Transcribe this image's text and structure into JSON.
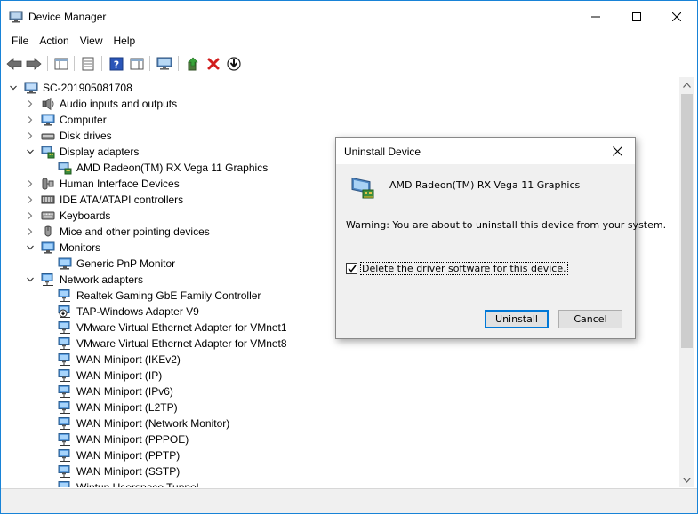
{
  "window": {
    "title": "Device Manager",
    "accent": "#1883d7"
  },
  "menu": [
    "File",
    "Action",
    "View",
    "Help"
  ],
  "tree": {
    "root": "SC-201905081708",
    "items": [
      {
        "label": "Audio inputs and outputs",
        "level": 1,
        "expanded": false,
        "icon": "speaker-icon"
      },
      {
        "label": "Computer",
        "level": 1,
        "expanded": false,
        "icon": "computer-icon"
      },
      {
        "label": "Disk drives",
        "level": 1,
        "expanded": false,
        "icon": "disk-drive-icon"
      },
      {
        "label": "Display adapters",
        "level": 1,
        "expanded": true,
        "icon": "display-adapter-icon"
      },
      {
        "label": "AMD Radeon(TM) RX Vega 11 Graphics",
        "level": 2,
        "icon": "display-adapter-icon"
      },
      {
        "label": "Human Interface Devices",
        "level": 1,
        "expanded": false,
        "icon": "hid-icon"
      },
      {
        "label": "IDE ATA/ATAPI controllers",
        "level": 1,
        "expanded": false,
        "icon": "ide-controller-icon"
      },
      {
        "label": "Keyboards",
        "level": 1,
        "expanded": false,
        "icon": "keyboard-icon"
      },
      {
        "label": "Mice and other pointing devices",
        "level": 1,
        "expanded": false,
        "icon": "mouse-icon"
      },
      {
        "label": "Monitors",
        "level": 1,
        "expanded": true,
        "icon": "monitor-icon"
      },
      {
        "label": "Generic PnP Monitor",
        "level": 2,
        "icon": "monitor-icon"
      },
      {
        "label": "Network adapters",
        "level": 1,
        "expanded": true,
        "icon": "network-icon"
      },
      {
        "label": "Realtek Gaming GbE Family Controller",
        "level": 2,
        "icon": "network-icon"
      },
      {
        "label": "TAP-Windows Adapter V9",
        "level": 2,
        "icon": "network-disabled-icon"
      },
      {
        "label": "VMware Virtual Ethernet Adapter for VMnet1",
        "level": 2,
        "icon": "network-icon"
      },
      {
        "label": "VMware Virtual Ethernet Adapter for VMnet8",
        "level": 2,
        "icon": "network-icon"
      },
      {
        "label": "WAN Miniport (IKEv2)",
        "level": 2,
        "icon": "network-icon"
      },
      {
        "label": "WAN Miniport (IP)",
        "level": 2,
        "icon": "network-icon"
      },
      {
        "label": "WAN Miniport (IPv6)",
        "level": 2,
        "icon": "network-icon"
      },
      {
        "label": "WAN Miniport (L2TP)",
        "level": 2,
        "icon": "network-icon"
      },
      {
        "label": "WAN Miniport (Network Monitor)",
        "level": 2,
        "icon": "network-icon"
      },
      {
        "label": "WAN Miniport (PPPOE)",
        "level": 2,
        "icon": "network-icon"
      },
      {
        "label": "WAN Miniport (PPTP)",
        "level": 2,
        "icon": "network-icon"
      },
      {
        "label": "WAN Miniport (SSTP)",
        "level": 2,
        "icon": "network-icon"
      },
      {
        "label": "Wintun Userspace Tunnel",
        "level": 2,
        "icon": "network-icon"
      }
    ]
  },
  "dialog": {
    "title": "Uninstall Device",
    "device_name": "AMD Radeon(TM) RX Vega 11 Graphics",
    "warning": "Warning: You are about to uninstall this device from your system.",
    "checkbox_label": "Delete the driver software for this device.",
    "checkbox_checked": true,
    "uninstall_label": "Uninstall",
    "cancel_label": "Cancel"
  }
}
